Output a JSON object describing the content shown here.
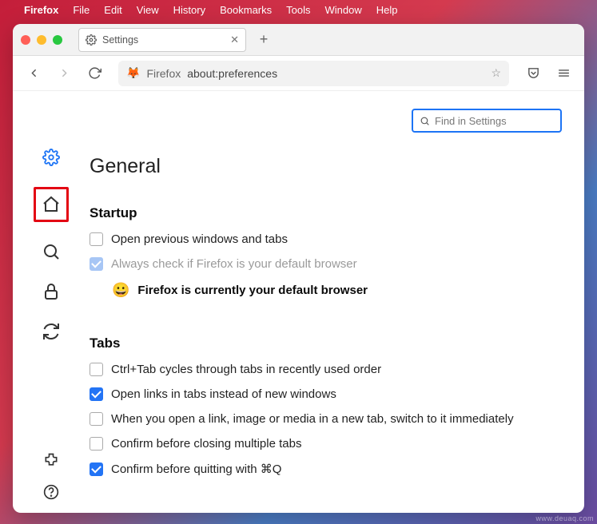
{
  "menubar": {
    "app": "Firefox",
    "items": [
      "File",
      "Edit",
      "View",
      "History",
      "Bookmarks",
      "Tools",
      "Window",
      "Help"
    ]
  },
  "tab": {
    "title": "Settings"
  },
  "urlbar": {
    "context": "Firefox",
    "url": "about:preferences"
  },
  "search": {
    "placeholder": "Find in Settings"
  },
  "page": {
    "title": "General",
    "startup": {
      "heading": "Startup",
      "opt_prev": "Open previous windows and tabs",
      "opt_default": "Always check if Firefox is your default browser",
      "status": "Firefox is currently your default browser"
    },
    "tabs": {
      "heading": "Tabs",
      "opt_ctrltab": "Ctrl+Tab cycles through tabs in recently used order",
      "opt_links": "Open links in tabs instead of new windows",
      "opt_switch": "When you open a link, image or media in a new tab, switch to it immediately",
      "opt_close": "Confirm before closing multiple tabs",
      "opt_quit": "Confirm before quitting with ⌘Q"
    }
  },
  "watermark": "www.deuaq.com"
}
